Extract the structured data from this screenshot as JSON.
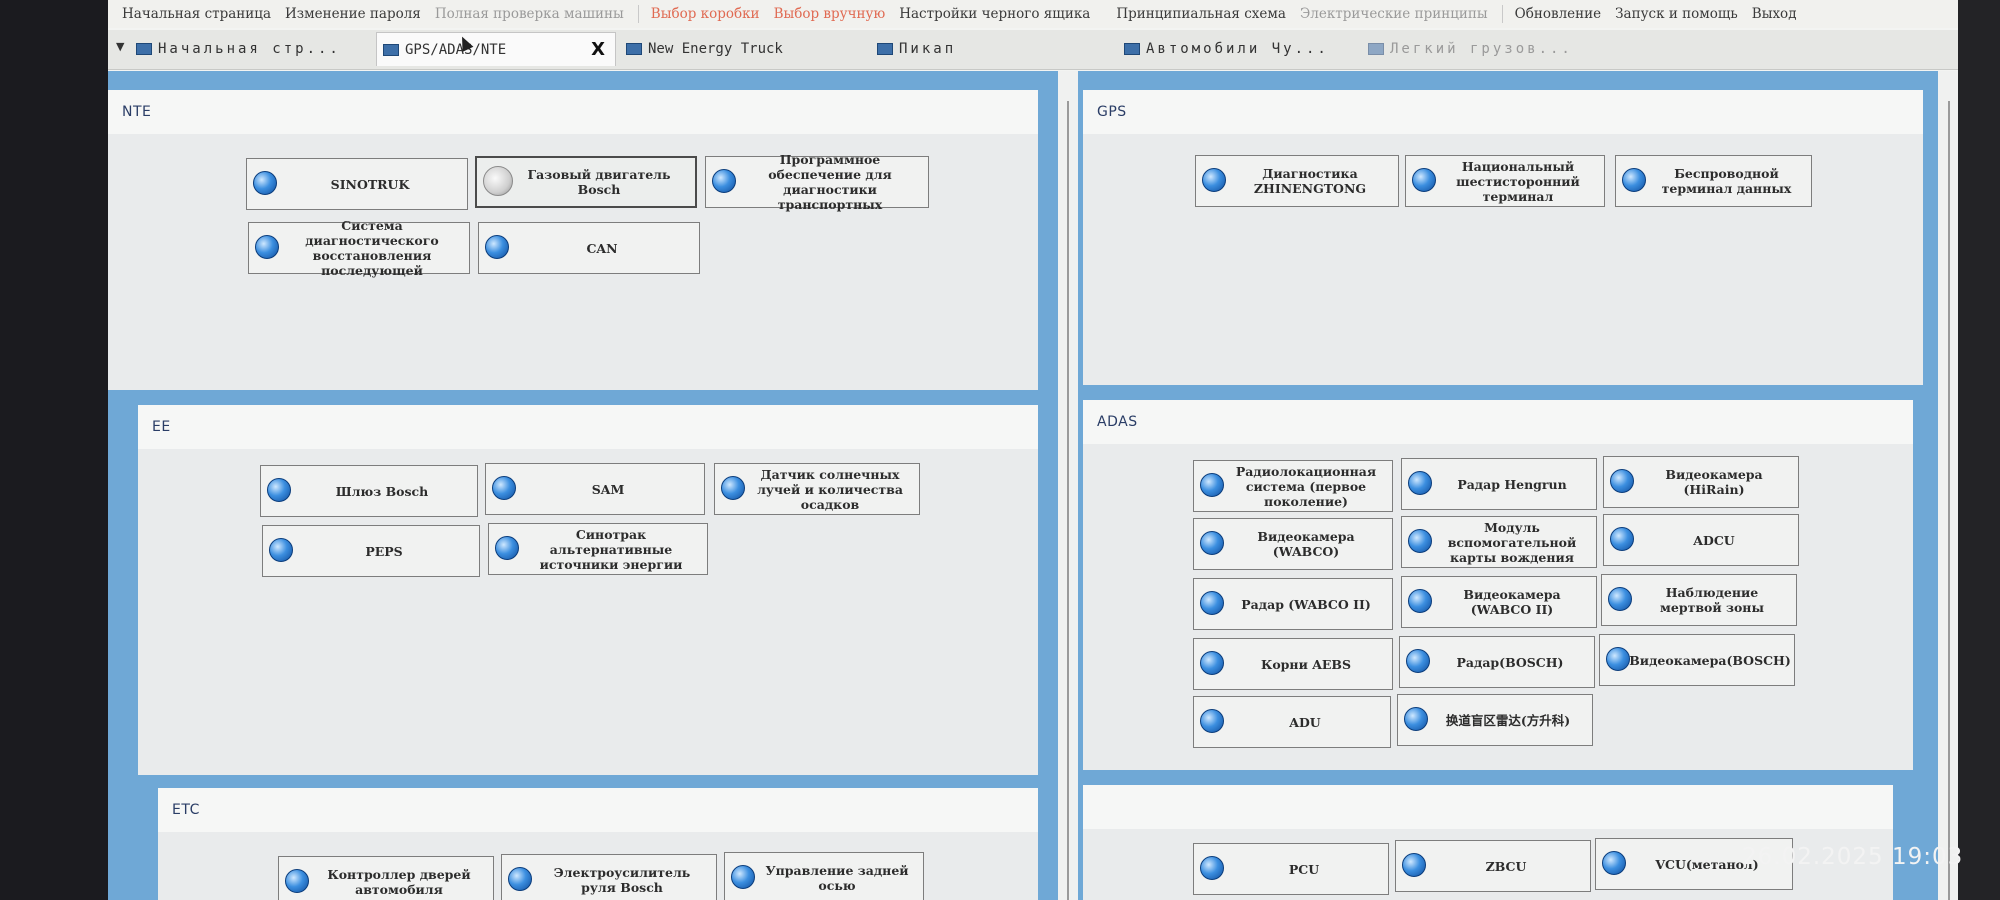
{
  "menu": {
    "items": [
      {
        "label": "Начальная страница"
      },
      {
        "label": "Изменение пароля"
      },
      {
        "label": "Полная проверка машины"
      },
      {
        "label": "Выбор коробки"
      },
      {
        "label": "Выбор вручную"
      },
      {
        "label": "Настройки черного ящика"
      },
      {
        "label": "Принципиальная схема"
      },
      {
        "label": "Электрические принципы"
      },
      {
        "label": "Обновление"
      },
      {
        "label": "Запуск и помощь"
      },
      {
        "label": "Выход"
      }
    ]
  },
  "tabs": [
    {
      "label": "Начальная стр..."
    },
    {
      "label": "GPS/ADAS/NTE",
      "close": "X"
    },
    {
      "label": "New Energy Truck"
    },
    {
      "label": "Пикап"
    },
    {
      "label": "Автомобили Чу..."
    },
    {
      "label": "Легкий грузов..."
    }
  ],
  "panels": {
    "nte": {
      "title": "NTE",
      "buttons": [
        {
          "label": "SINOTRUK"
        },
        {
          "label": "Газовый двигатель Bosch"
        },
        {
          "label": "Программное обеспечение для диагностики транспортных"
        },
        {
          "label": "Система диагностического восстановления последующей"
        },
        {
          "label": "CAN"
        }
      ]
    },
    "gps": {
      "title": "GPS",
      "buttons": [
        {
          "label": "Диагностика ZHINENGTONG"
        },
        {
          "label": "Национальный шестисторонний терминал"
        },
        {
          "label": "Беспроводной терминал данных"
        }
      ]
    },
    "ee": {
      "title": "EE",
      "buttons": [
        {
          "label": "Шлюз Bosch"
        },
        {
          "label": "SAM"
        },
        {
          "label": "Датчик солнечных лучей и количества осадков"
        },
        {
          "label": "PEPS"
        },
        {
          "label": "Синотрак альтернативные источники энергии"
        }
      ]
    },
    "adas": {
      "title": "ADAS",
      "buttons": [
        {
          "label": "Радиолокационная система (первое поколение)"
        },
        {
          "label": "Радар Hengrun"
        },
        {
          "label": "Видеокамера (HiRain)"
        },
        {
          "label": "Видеокамера (WABCO)"
        },
        {
          "label": "Модуль вспомогательной карты вождения"
        },
        {
          "label": "ADCU"
        },
        {
          "label": "Радар (WABCO II)"
        },
        {
          "label": "Видеокамера (WABCO II)"
        },
        {
          "label": "Наблюдение мертвой зоны"
        },
        {
          "label": "Корни AEBS"
        },
        {
          "label": "Радар(BOSCH)"
        },
        {
          "label": "Видеокамера(BOSCH)"
        },
        {
          "label": "ADU"
        },
        {
          "label": "换道盲区雷达(方升科)"
        }
      ]
    },
    "etc": {
      "title": "ETC",
      "buttons": [
        {
          "label": "Контроллер дверей автомобиля"
        },
        {
          "label": "Электроусилитель руля Bosch"
        },
        {
          "label": "Управление задней осью"
        }
      ]
    },
    "bottom_right": {
      "title": "",
      "buttons": [
        {
          "label": "PCU"
        },
        {
          "label": "ZBCU"
        },
        {
          "label": "VCU(метанол)"
        }
      ]
    }
  },
  "overlay": {
    "timestamp": "26.02.2025  19:03"
  }
}
